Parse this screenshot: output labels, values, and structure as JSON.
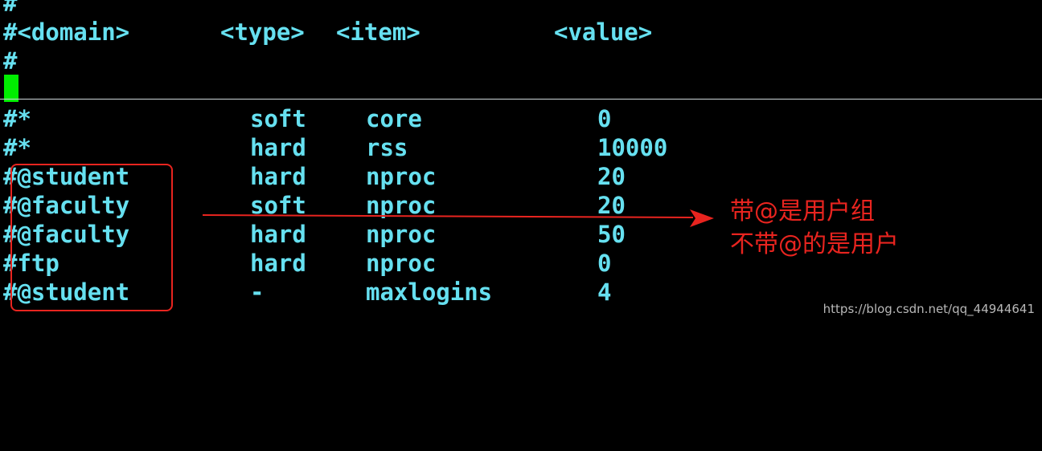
{
  "header": {
    "line1": "#",
    "line2": {
      "domain": "#<domain>",
      "type": "<type>",
      "item": "<item>",
      "value": "<value>"
    },
    "line3": "#"
  },
  "rows": [
    {
      "domain": "#*",
      "type": "soft",
      "item": "core",
      "value": "0"
    },
    {
      "domain": "#*",
      "type": "hard",
      "item": "rss",
      "value": "10000"
    },
    {
      "domain": "#@student",
      "type": "hard",
      "item": "nproc",
      "value": "20"
    },
    {
      "domain": "#@faculty",
      "type": "soft",
      "item": "nproc",
      "value": "20"
    },
    {
      "domain": "#@faculty",
      "type": "hard",
      "item": "nproc",
      "value": "50"
    },
    {
      "domain": "#ftp",
      "type": "hard",
      "item": "nproc",
      "value": "0"
    },
    {
      "domain": "#@student",
      "type": "-",
      "item": "maxlogins",
      "value": "4"
    }
  ],
  "annotation": {
    "line1": "带@是用户组",
    "line2": "不带@的是用户"
  },
  "watermark": "https://blog.csdn.net/qq_44944641",
  "colors": {
    "text": "#66e0f0",
    "cursor": "#00ee00",
    "annotation": "#e8241f",
    "background": "#000000"
  }
}
